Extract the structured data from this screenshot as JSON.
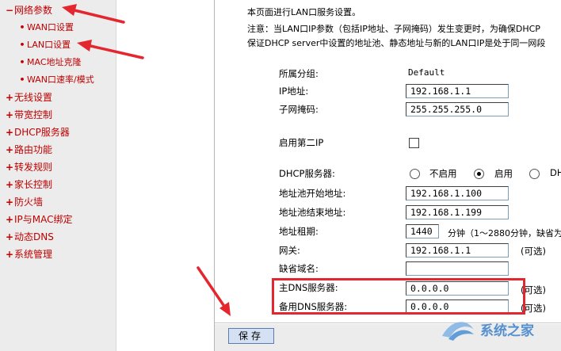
{
  "sidebar": {
    "items": [
      {
        "label": "网络参数",
        "marker": "−",
        "expanded": true
      },
      {
        "label": "WAN口设置",
        "marker": "•",
        "sub": true
      },
      {
        "label": "LAN口设置",
        "marker": "•",
        "sub": true
      },
      {
        "label": "MAC地址克隆",
        "marker": "•",
        "sub": true
      },
      {
        "label": "WAN口速率/模式",
        "marker": "•",
        "sub": true
      },
      {
        "label": "无线设置",
        "marker": "+"
      },
      {
        "label": "带宽控制",
        "marker": "+"
      },
      {
        "label": "DHCP服务器",
        "marker": "+"
      },
      {
        "label": "路由功能",
        "marker": "+"
      },
      {
        "label": "转发规则",
        "marker": "+"
      },
      {
        "label": "家长控制",
        "marker": "+"
      },
      {
        "label": "防火墙",
        "marker": "+"
      },
      {
        "label": "IP与MAC绑定",
        "marker": "+"
      },
      {
        "label": "动态DNS",
        "marker": "+"
      },
      {
        "label": "系统管理",
        "marker": "+"
      }
    ]
  },
  "content": {
    "intro_line1": "本页面进行LAN口服务设置。",
    "intro_line2": "注意：当LAN口IP参数（包括IP地址、子网掩码）发生变更时，为确保DHCP",
    "intro_line3": "保证DHCP server中设置的地址池、静态地址与新的LAN口IP是处于同一网段",
    "group_label": "所属分组:",
    "group_value": "Default",
    "ip_label": "IP地址:",
    "ip_value": "192.168.1.1",
    "mask_label": "子网掩码:",
    "mask_value": "255.255.255.0",
    "second_ip_label": "启用第二IP",
    "dhcp_label": "DHCP服务器:",
    "dhcp_opt_disable": "不启用",
    "dhcp_opt_enable": "启用",
    "dhcp_opt_third": "DH",
    "dhcp_selected": "启用",
    "pool_start_label": "地址池开始地址:",
    "pool_start_value": "192.168.1.100",
    "pool_end_label": "地址池结束地址:",
    "pool_end_value": "192.168.1.199",
    "lease_label": "地址租期:",
    "lease_value": "1440",
    "lease_unit": "分钟（1～2880分钟，缺省为",
    "gateway_label": "网关:",
    "gateway_value": "192.168.1.1",
    "optional": "(可选)",
    "domain_label": "缺省域名:",
    "domain_value": "",
    "dns1_label": "主DNS服务器:",
    "dns1_value": "0.0.0.0",
    "dns2_label": "备用DNS服务器:",
    "dns2_value": "0.0.0.0",
    "save_label": "保存"
  },
  "annotation": {
    "arrow_color": "#e4262f"
  },
  "watermark": {
    "text": "系统之家"
  }
}
